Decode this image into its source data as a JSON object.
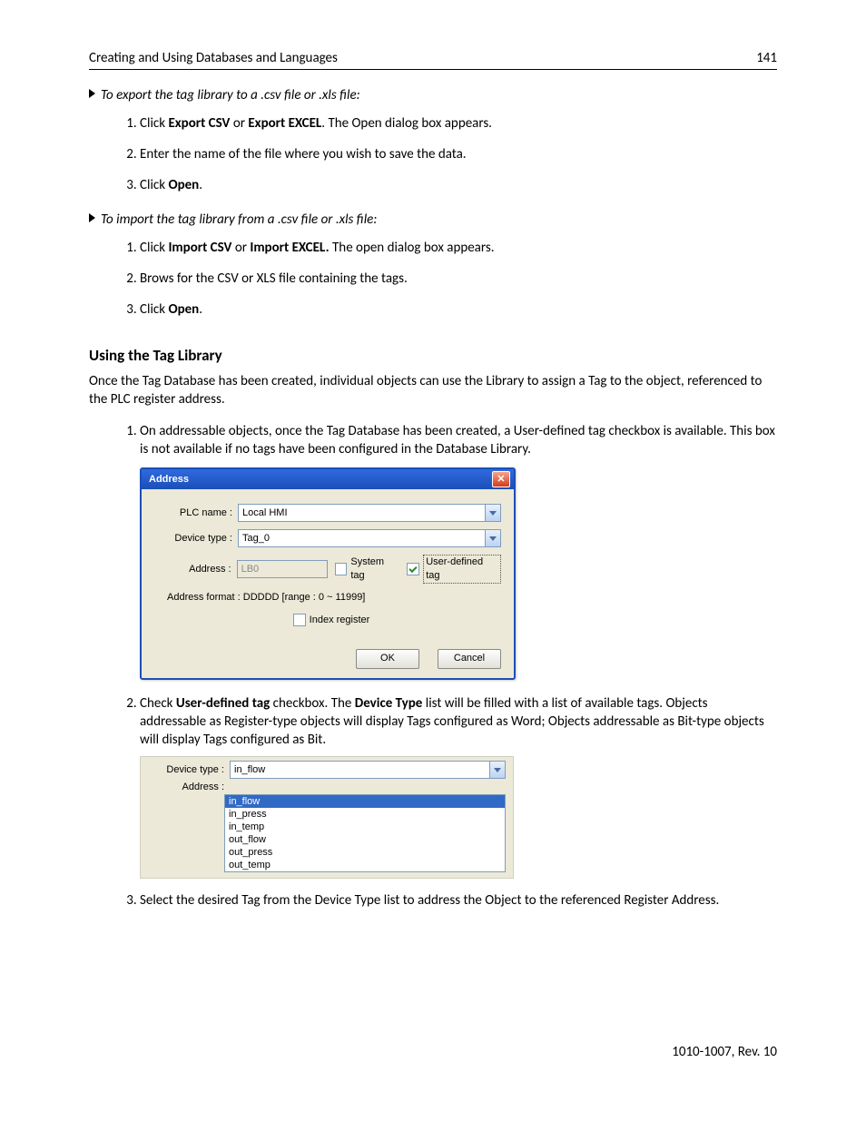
{
  "header": {
    "left": "Creating and Using Databases and Languages",
    "right": "141"
  },
  "export": {
    "heading": "To export the tag library to a .csv file or .xls file:",
    "s1_a": "Click ",
    "s1_b": "Export CSV",
    "s1_c": " or ",
    "s1_d": "Export EXCEL",
    "s1_e": ". The Open dialog box appears.",
    "s2": "Enter the name of the file where you wish to save the data.",
    "s3_a": "Click ",
    "s3_b": "Open",
    "s3_c": "."
  },
  "import": {
    "heading": "To import the tag library from a .csv file or .xls file:",
    "s1_a": "Click ",
    "s1_b": "Import CSV",
    "s1_c": " or ",
    "s1_d": "Import EXCEL.",
    "s1_e": " The open dialog box appears.",
    "s2": "Brows for the CSV or XLS file containing the tags.",
    "s3_a": "Click ",
    "s3_b": "Open",
    "s3_c": "."
  },
  "section": {
    "title": "Using the Tag Library",
    "intro": "Once the Tag Database has been created, individual objects can use the Library to assign a Tag to the object, referenced to the PLC register address.",
    "li1": "On addressable objects, once the Tag Database has been created, a User-defined tag checkbox is available. This box is not available if no tags have been configured in the Database Library.",
    "li2_a": "Check ",
    "li2_b": "User-defined tag",
    "li2_c": " checkbox. The ",
    "li2_d": "Device Type",
    "li2_e": " list will be filled with a list of available tags. Objects addressable as Register-type objects will display Tags configured as Word; Objects addressable as Bit-type objects will display Tags configured as Bit.",
    "li3": "Select the desired Tag from the Device Type list to address the Object to the referenced Register Address."
  },
  "dlg": {
    "title": "Address",
    "labels": {
      "plc": "PLC name :",
      "dev": "Device type :",
      "addr": "Address :",
      "fmt": "Address format : DDDDD [range : 0 ~ 11999]"
    },
    "values": {
      "plc": "Local HMI",
      "dev": "Tag_0",
      "addr": "LB0"
    },
    "checks": {
      "system": "System tag",
      "user": "User-defined tag",
      "index": "Index register"
    },
    "buttons": {
      "ok": "OK",
      "cancel": "Cancel"
    }
  },
  "list": {
    "devlab": "Device type :",
    "addrlab": "Address :",
    "selected": "in_flow",
    "opts": [
      "in_flow",
      "in_press",
      "in_temp",
      "out_flow",
      "out_press",
      "out_temp"
    ]
  },
  "footer": "1010-1007, Rev. 10"
}
